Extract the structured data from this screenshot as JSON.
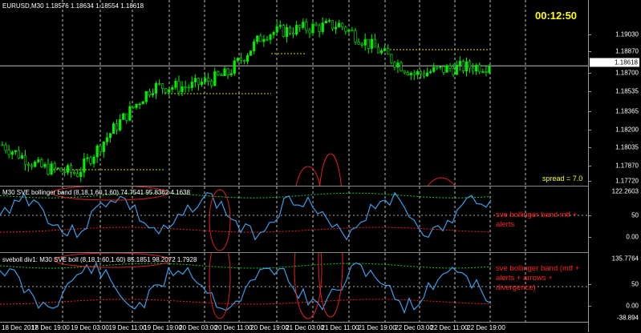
{
  "chart": {
    "symbol_info": "EURUSD,M30  1.18576 1.18634 1.18554 1.18618",
    "timer": "00:12:50",
    "spread": "spread = 7.0",
    "current_price": "1.18618",
    "price_labels": [
      "1.19030",
      "1.18870",
      "1.18700",
      "1.18535",
      "1.18365",
      "1.18200",
      "1.18035",
      "1.17870",
      "1.17720"
    ],
    "price_range": [
      1.1765,
      1.1915
    ],
    "candle_colors": {
      "up": "#00ee00",
      "down": "#ffffff"
    }
  },
  "indicator1": {
    "label": "M30 SVE bollinger band (8,18,1.60,1.60) 74.7541 95.8362 4.1638",
    "levels": [
      "122.2603",
      "50",
      "0.00"
    ],
    "annotation": "sve bollinger band  mtf + alerts"
  },
  "indicator2": {
    "label": "sveboll div1: M30 SVE boll (8,18,1.60,1.60) 85.1851 98.2072 1.7928",
    "levels": [
      "135.7764",
      "50",
      "0.00",
      "-38.894"
    ],
    "annotation": "sve bollinger band  (mtf + alerts + arrows + divergence)"
  },
  "time_axis": [
    "18 Dec 2017",
    "18 Dec 19:00",
    "19 Dec 03:00",
    "19 Dec 11:00",
    "19 Dec 19:00",
    "20 Dec 03:00",
    "20 Dec 11:00",
    "20 Dec 19:00",
    "21 Dec 03:00",
    "21 Dec 11:00",
    "21 Dec 19:00",
    "22 Dec 03:00",
    "22 Dec 11:00",
    "22 Dec 19:00"
  ],
  "chart_data": {
    "type": "candlestick",
    "title": "EURUSD,M30",
    "x": [
      "18 Dec 2017",
      "18 Dec 19:00",
      "19 Dec 03:00",
      "19 Dec 11:00",
      "19 Dec 19:00",
      "20 Dec 03:00",
      "20 Dec 11:00",
      "20 Dec 19:00",
      "21 Dec 03:00",
      "21 Dec 11:00",
      "21 Dec 19:00",
      "22 Dec 03:00",
      "22 Dec 11:00",
      "22 Dec 19:00"
    ],
    "close_approx": [
      1.1798,
      1.178,
      1.1775,
      1.1812,
      1.1845,
      1.1845,
      1.1855,
      1.1888,
      1.1892,
      1.1895,
      1.1875,
      1.1855,
      1.186,
      1.1862
    ],
    "ylim": [
      1.1765,
      1.1915
    ],
    "current_close": 1.18618
  }
}
